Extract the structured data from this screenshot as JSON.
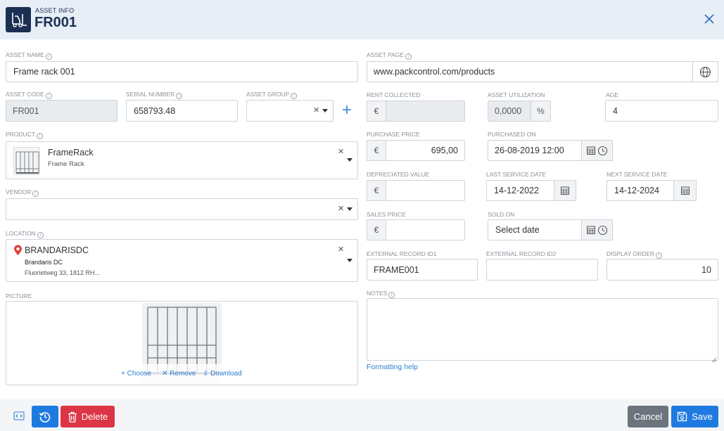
{
  "header": {
    "subtitle": "ASSET INFO",
    "title": "FR001"
  },
  "fields": {
    "asset_name": {
      "label": "ASSET NAME",
      "value": "Frame rack 001"
    },
    "asset_page": {
      "label": "ASSET PAGE",
      "value": "www.packcontrol.com/products"
    },
    "asset_code": {
      "label": "ASSET CODE",
      "value": "FR001"
    },
    "serial_number": {
      "label": "SERIAL NUMBER",
      "value": "658793.48"
    },
    "asset_group": {
      "label": "ASSET GROUP",
      "value": ""
    },
    "rent_collected": {
      "label": "RENT COLLECTED",
      "currency": "€",
      "value": ""
    },
    "asset_utilization": {
      "label": "ASSET UTILIZATION",
      "value": "0,0000",
      "unit": "%"
    },
    "age": {
      "label": "AGE",
      "value": "4"
    },
    "product": {
      "label": "PRODUCT",
      "name": "FrameRack",
      "description": "Frame Rack"
    },
    "purchase_price": {
      "label": "PURCHASE PRICE",
      "currency": "€",
      "value": "695,00"
    },
    "purchased_on": {
      "label": "PURCHASED ON",
      "value": "26-08-2019 12:00"
    },
    "depreciated_value": {
      "label": "DEPRECIATED VALUE",
      "currency": "€",
      "value": ""
    },
    "last_service_date": {
      "label": "LAST SERVICE DATE",
      "value": "14-12-2022"
    },
    "next_service_date": {
      "label": "NEXT SERVICE DATE",
      "value": "14-12-2024"
    },
    "vendor": {
      "label": "VENDOR",
      "value": ""
    },
    "sales_price": {
      "label": "SALES PRICE",
      "currency": "€",
      "value": ""
    },
    "sold_on": {
      "label": "SOLD ON",
      "value": "Select date"
    },
    "location": {
      "label": "LOCATION",
      "code": "BRANDARISDC",
      "name": "Brandaris DC",
      "address": "Fluorietweg 33, 1812 RH..."
    },
    "external_record_id1": {
      "label": "EXTERNAL RECORD ID1",
      "value": "FRAME001"
    },
    "external_record_id2": {
      "label": "EXTERNAL RECORD ID2",
      "value": ""
    },
    "display_order": {
      "label": "DISPLAY ORDER",
      "value": "10"
    },
    "picture": {
      "label": "PICTURE",
      "choose": "Choose",
      "remove": "Remove",
      "download": "Download"
    },
    "notes": {
      "label": "NOTES",
      "value": "",
      "help_link": "Formatting help"
    }
  },
  "footer": {
    "delete_label": "Delete",
    "cancel_label": "Cancel",
    "save_label": "Save"
  },
  "colors": {
    "header_bg": "#e8eef6",
    "brand_navy": "#1a2f52",
    "primary": "#0d6efd",
    "danger": "#dc3545",
    "secondary": "#6c757d",
    "link": "#2a7fd4"
  }
}
